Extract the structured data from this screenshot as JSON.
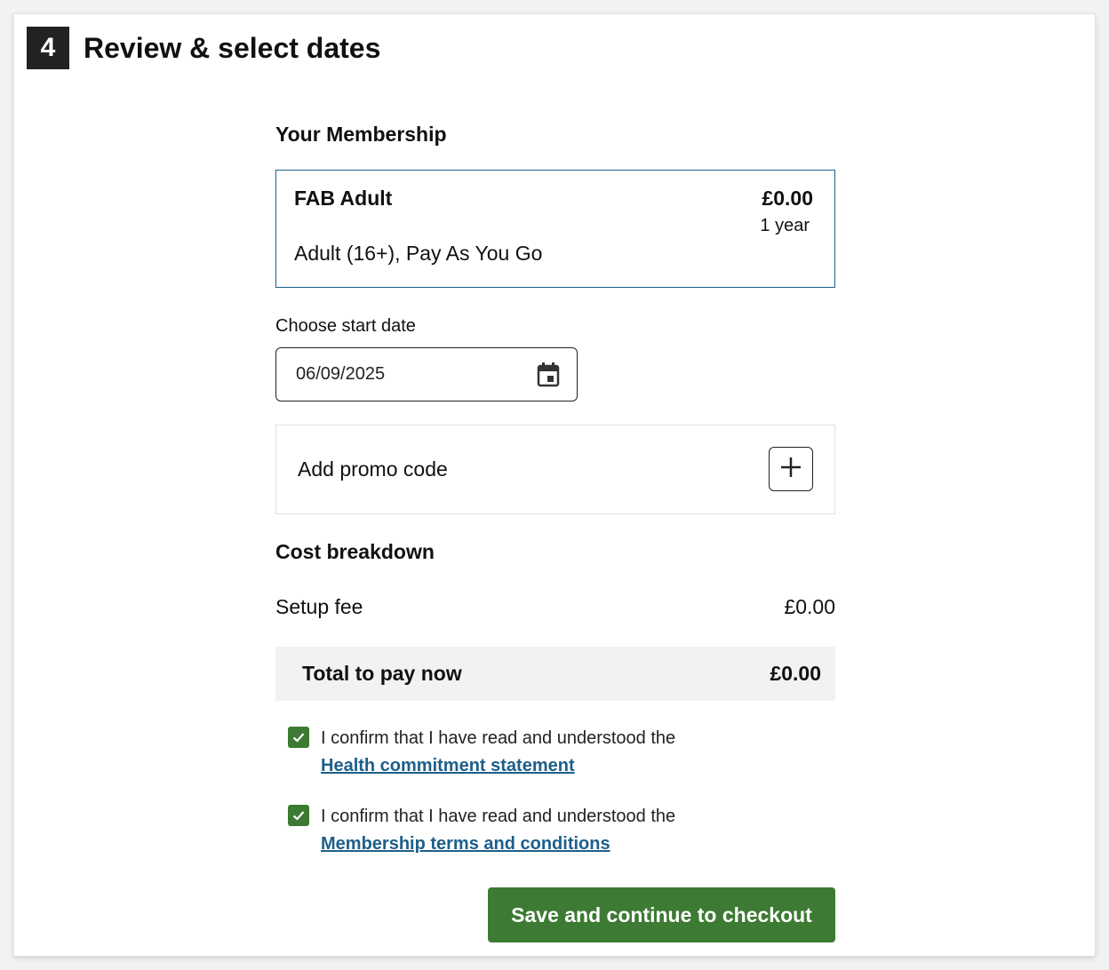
{
  "step": {
    "number": "4",
    "title": "Review & select dates"
  },
  "membership": {
    "heading": "Your Membership",
    "name": "FAB Adult",
    "description": "Adult (16+), Pay As You Go",
    "price": "£0.00",
    "term": "1 year"
  },
  "start_date": {
    "label": "Choose start date",
    "value": "06/09/2025",
    "icon": "calendar-icon"
  },
  "promo": {
    "label": "Add promo code",
    "icon": "plus-icon"
  },
  "cost": {
    "heading": "Cost breakdown",
    "setup_fee_label": "Setup fee",
    "setup_fee_value": "£0.00",
    "total_label": "Total to pay now",
    "total_value": "£0.00"
  },
  "confirmations": [
    {
      "text": "I confirm that I have read and understood the",
      "link": "Health commitment statement",
      "checked": true
    },
    {
      "text": "I confirm that I have read and understood the",
      "link": "Membership terms and conditions",
      "checked": true
    }
  ],
  "cta": {
    "label": "Save and continue to checkout"
  },
  "colors": {
    "accent_green": "#3d7a33",
    "link_blue": "#1d5f8a",
    "dark": "#222222"
  }
}
